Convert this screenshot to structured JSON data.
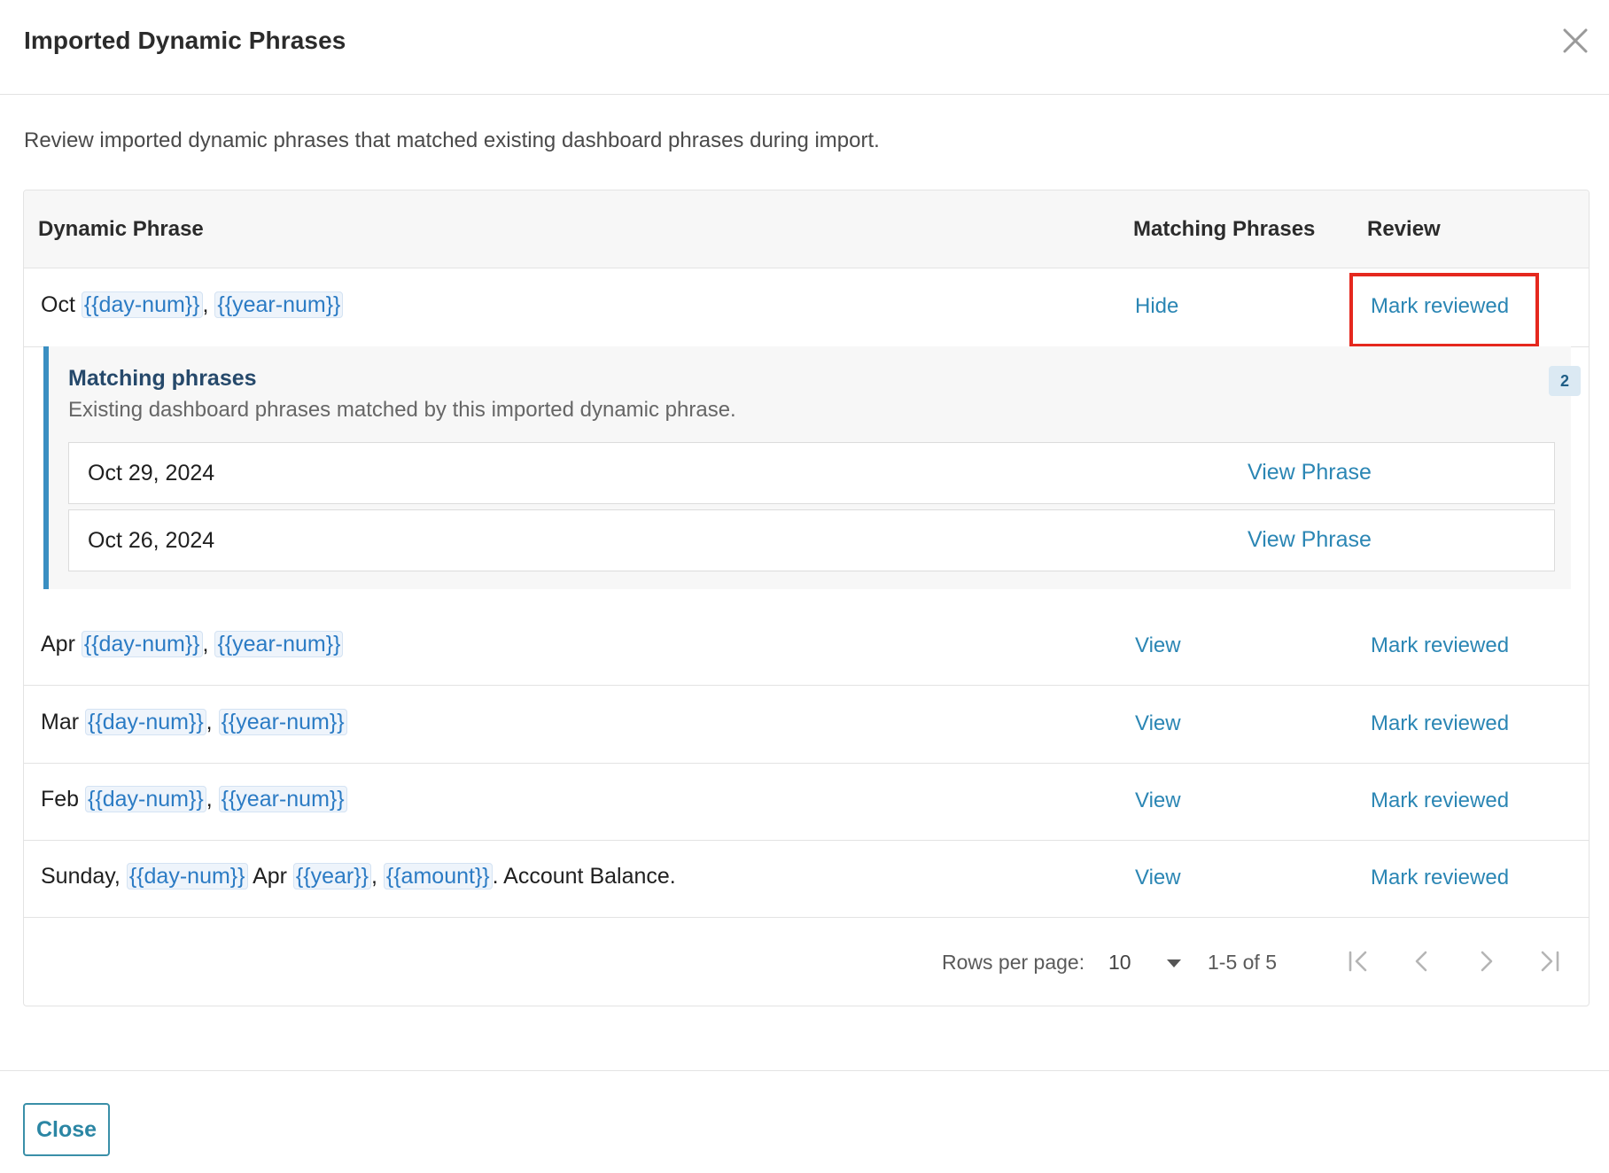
{
  "dialog": {
    "title": "Imported Dynamic Phrases",
    "description": "Review imported dynamic phrases that matched existing dashboard phrases during import.",
    "close_label": "Close"
  },
  "table": {
    "headers": {
      "phrase": "Dynamic Phrase",
      "matching": "Matching Phrases",
      "review": "Review"
    },
    "rows": [
      {
        "parts": [
          {
            "text": "Oct ",
            "token": false
          },
          {
            "text": "{{day-num}}",
            "token": true
          },
          {
            "text": ", ",
            "token": false
          },
          {
            "text": "{{year-num}}",
            "token": true
          }
        ],
        "matching_action": "Hide",
        "review_action": "Mark reviewed"
      },
      {
        "parts": [
          {
            "text": "Apr ",
            "token": false
          },
          {
            "text": "{{day-num}}",
            "token": true
          },
          {
            "text": ", ",
            "token": false
          },
          {
            "text": "{{year-num}}",
            "token": true
          }
        ],
        "matching_action": "View",
        "review_action": "Mark reviewed"
      },
      {
        "parts": [
          {
            "text": "Mar ",
            "token": false
          },
          {
            "text": "{{day-num}}",
            "token": true
          },
          {
            "text": ", ",
            "token": false
          },
          {
            "text": "{{year-num}}",
            "token": true
          }
        ],
        "matching_action": "View",
        "review_action": "Mark reviewed"
      },
      {
        "parts": [
          {
            "text": "Feb ",
            "token": false
          },
          {
            "text": "{{day-num}}",
            "token": true
          },
          {
            "text": ", ",
            "token": false
          },
          {
            "text": "{{year-num}}",
            "token": true
          }
        ],
        "matching_action": "View",
        "review_action": "Mark reviewed"
      },
      {
        "parts": [
          {
            "text": "Sunday, ",
            "token": false
          },
          {
            "text": "{{day-num}}",
            "token": true
          },
          {
            "text": " Apr ",
            "token": false
          },
          {
            "text": "{{year}}",
            "token": true
          },
          {
            "text": ", ",
            "token": false
          },
          {
            "text": "{{amount}}",
            "token": true
          },
          {
            "text": ". Account Balance.",
            "token": false
          }
        ],
        "matching_action": "View",
        "review_action": "Mark reviewed"
      }
    ]
  },
  "expanded": {
    "title": "Matching phrases",
    "subtitle": "Existing dashboard phrases matched by this imported dynamic phrase.",
    "count": "2",
    "items": [
      {
        "date": "Oct 29, 2024",
        "action": "View Phrase"
      },
      {
        "date": "Oct 26, 2024",
        "action": "View Phrase"
      }
    ]
  },
  "pagination": {
    "rows_per_page_label": "Rows per page:",
    "rows_per_page_value": "10",
    "range": "1-5 of 5"
  },
  "colors": {
    "link": "#2b86b4",
    "token": "#2b7bc4",
    "accent_bar": "#3a8fc2",
    "highlight": "#e5281e"
  },
  "icons": {
    "close": "close-icon",
    "first_page": "first-page-icon",
    "prev_page": "chevron-left-icon",
    "next_page": "chevron-right-icon",
    "last_page": "last-page-icon",
    "dropdown": "caret-down-icon"
  }
}
